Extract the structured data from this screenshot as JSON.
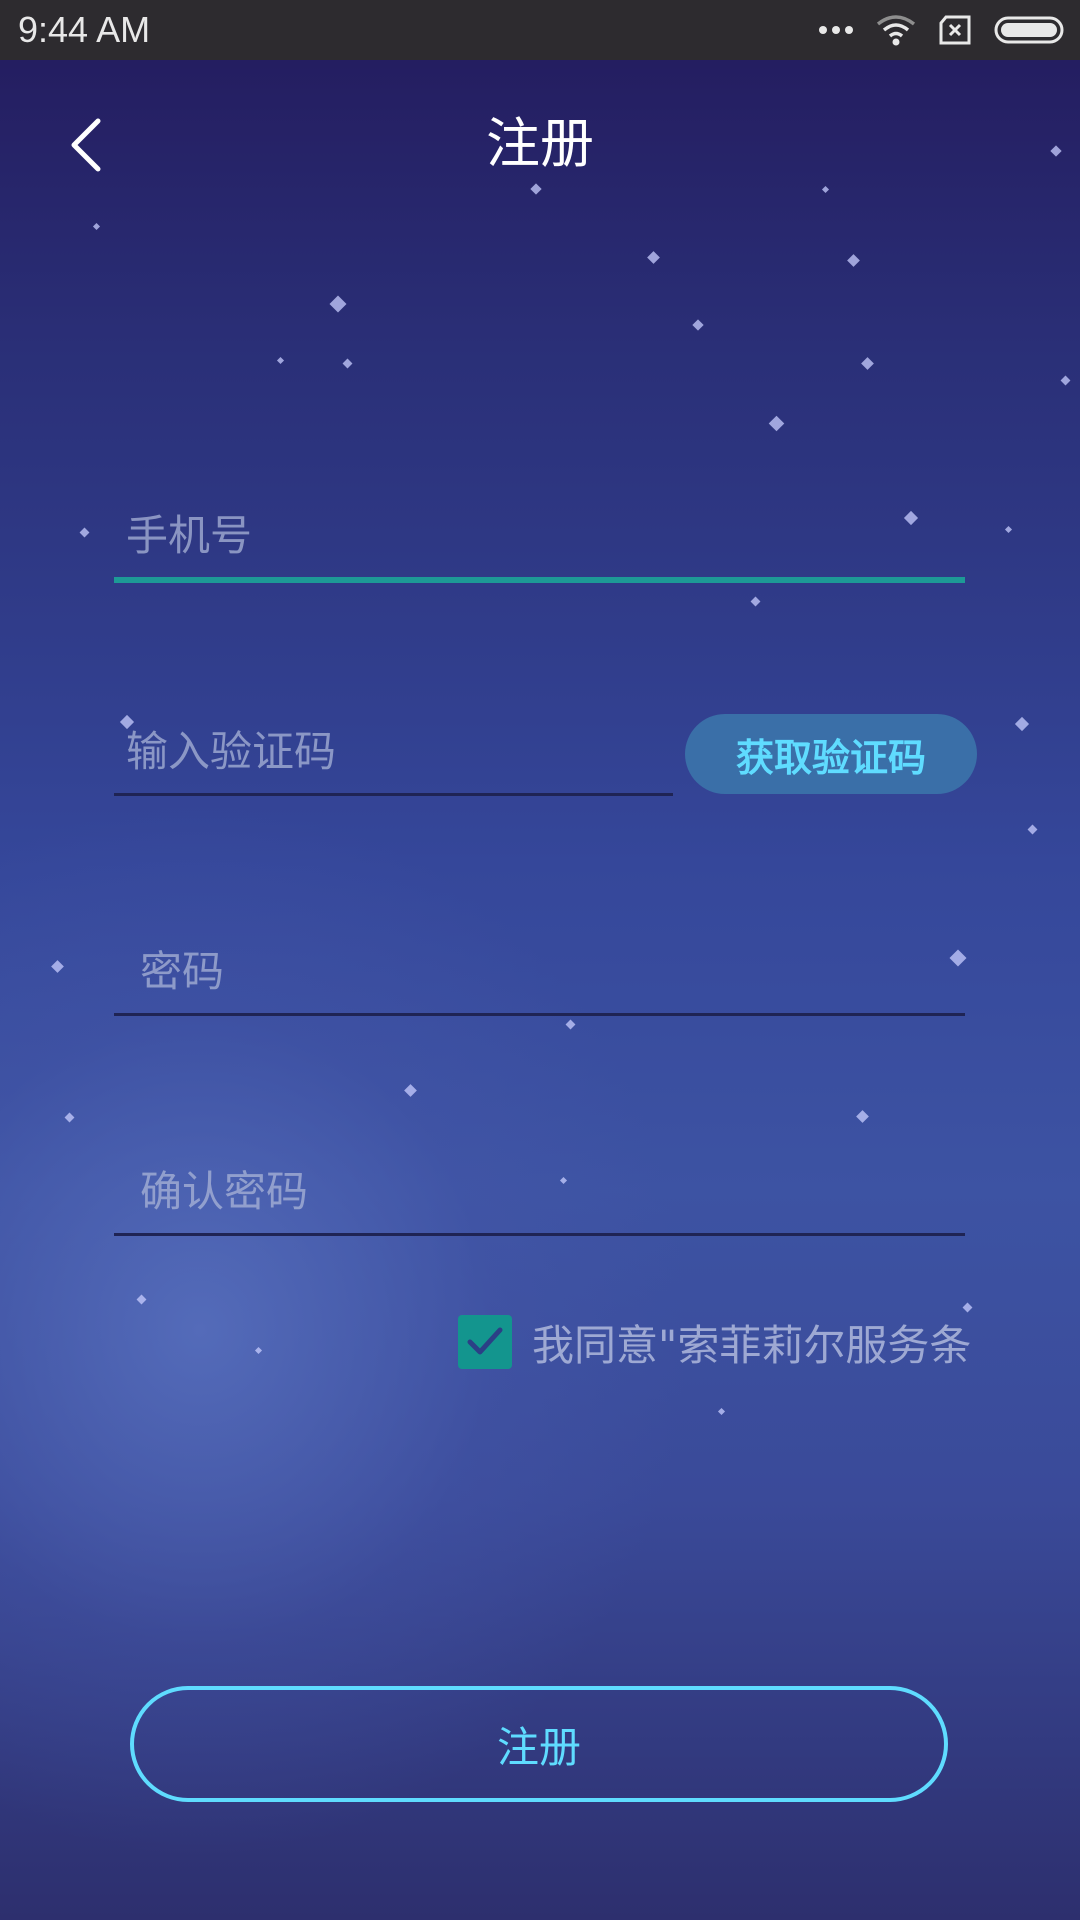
{
  "status_bar": {
    "time": "9:44 AM",
    "icons": [
      "more-dots-icon",
      "wifi-icon",
      "sim-x-icon",
      "battery-icon"
    ]
  },
  "header": {
    "title": "注册",
    "back_icon": "chevron-left-icon"
  },
  "form": {
    "phone_placeholder": "手机号",
    "code_placeholder": "输入验证码",
    "get_code_label": "获取验证码",
    "password_placeholder": "密码",
    "confirm_password_placeholder": "确认密码",
    "agree_checked": true,
    "agree_text": "我同意\"索菲莉尔服务条",
    "submit_label": "注册"
  },
  "colors": {
    "accent_cyan": "#5fdcff",
    "active_underline": "#1d9a96",
    "checkbox": "#13958e",
    "code_button_bg": "#3a6fa8"
  }
}
